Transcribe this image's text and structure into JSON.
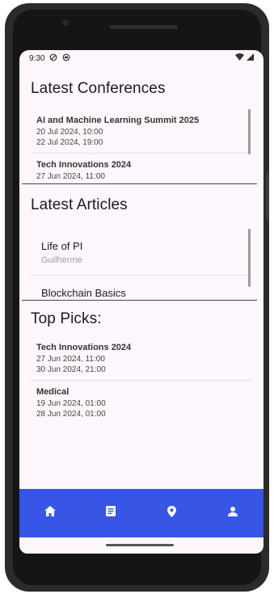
{
  "status_bar": {
    "time": "9:30"
  },
  "sections": {
    "conferences": {
      "title": "Latest Conferences",
      "items": [
        {
          "title": "AI and Machine Learning Summit 2025",
          "start": "20 Jul 2024, 10:00",
          "end": "22 Jul 2024, 19:00"
        },
        {
          "title": "Tech Innovations 2024",
          "start": "27 Jun 2024, 11:00"
        }
      ]
    },
    "articles": {
      "title": "Latest Articles",
      "items": [
        {
          "title": "Life of PI",
          "author": "Guilherme"
        },
        {
          "title": "Blockchain Basics"
        }
      ]
    },
    "top_picks": {
      "title": "Top Picks:",
      "items": [
        {
          "title": "Tech Innovations 2024",
          "start": "27 Jun 2024, 11:00",
          "end": "30 Jun 2024, 21:00"
        },
        {
          "title": "Medical",
          "start": "19 Jun 2024, 01:00",
          "end": "28 Jun 2024, 01:00"
        }
      ]
    }
  },
  "bottom_nav": {
    "items": [
      {
        "icon": "home-icon"
      },
      {
        "icon": "article-icon"
      },
      {
        "icon": "location-pin-icon"
      },
      {
        "icon": "person-icon"
      }
    ]
  },
  "colors": {
    "nav_background": "#3756e6",
    "screen_background": "#fdf7fd"
  }
}
